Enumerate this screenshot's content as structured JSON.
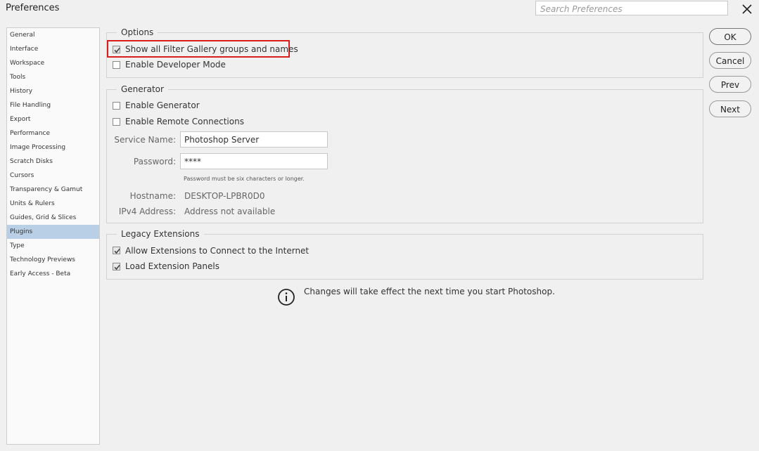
{
  "window": {
    "title": "Preferences"
  },
  "search": {
    "placeholder": "Search Preferences"
  },
  "sidebar": {
    "items": [
      "General",
      "Interface",
      "Workspace",
      "Tools",
      "History",
      "File Handling",
      "Export",
      "Performance",
      "Image Processing",
      "Scratch Disks",
      "Cursors",
      "Transparency & Gamut",
      "Units & Rulers",
      "Guides, Grid & Slices",
      "Plugins",
      "Type",
      "Technology Previews",
      "Early Access - Beta"
    ],
    "selected": "Plugins"
  },
  "options": {
    "legend": "Options",
    "show_filter_gallery": {
      "label": "Show all Filter Gallery groups and names",
      "checked": true
    },
    "developer_mode": {
      "label": "Enable Developer Mode",
      "checked": false
    }
  },
  "generator": {
    "legend": "Generator",
    "enable_generator": {
      "label": "Enable Generator",
      "checked": false
    },
    "remote_connections": {
      "label": "Enable Remote Connections",
      "checked": false
    },
    "service_name_label": "Service Name:",
    "service_name_value": "Photoshop Server",
    "password_label": "Password:",
    "password_value": "****",
    "password_hint": "Password must be six characters or longer.",
    "hostname_label": "Hostname:",
    "hostname_value": "DESKTOP-LPBR0D0",
    "ipv4_label": "IPv4 Address:",
    "ipv4_value": "Address not available"
  },
  "legacy": {
    "legend": "Legacy Extensions",
    "allow_internet": {
      "label": "Allow Extensions to Connect to the Internet",
      "checked": true
    },
    "load_panels": {
      "label": "Load Extension Panels",
      "checked": true
    }
  },
  "info": {
    "text": "Changes will take effect the next time you start Photoshop."
  },
  "buttons": {
    "ok": "OK",
    "cancel": "Cancel",
    "prev": "Prev",
    "next": "Next"
  },
  "colors": {
    "selected_item": "#b8cfe6",
    "highlight_border": "#d91c1c"
  }
}
